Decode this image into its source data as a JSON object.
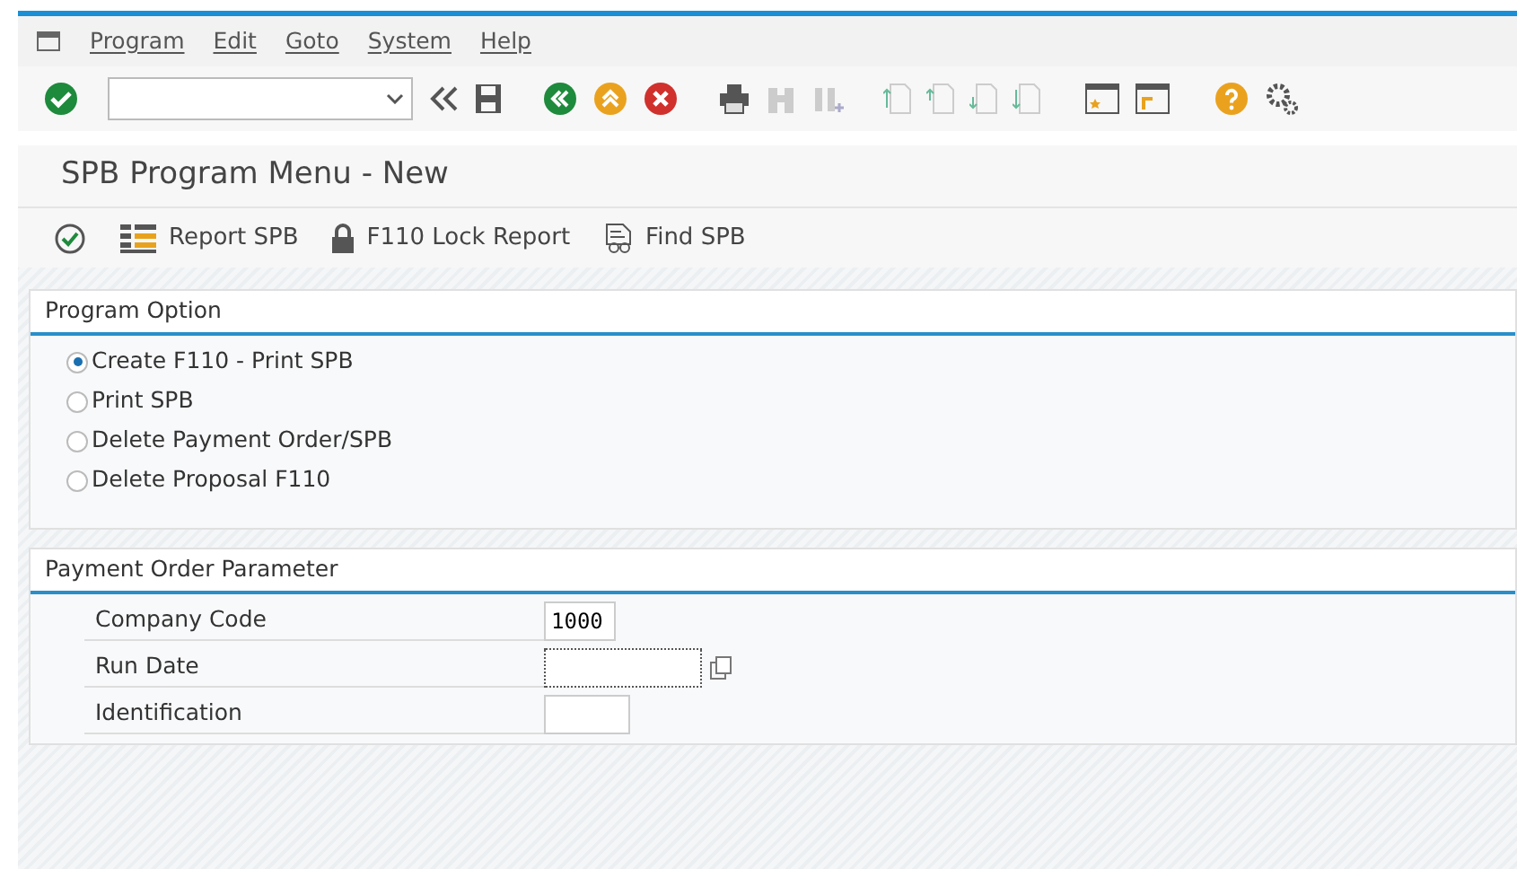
{
  "menu_bar": [
    "Program",
    "Edit",
    "Goto",
    "System",
    "Help"
  ],
  "title": "SPB Program Menu - New",
  "app_toolbar": [
    {
      "kind": "execute"
    },
    {
      "kind": "report",
      "label": "Report SPB"
    },
    {
      "kind": "lock",
      "label": "F110 Lock Report"
    },
    {
      "kind": "find",
      "label": "Find SPB"
    }
  ],
  "program_option": {
    "title": "Program Option",
    "options": [
      {
        "label": "Create F110 - Print SPB",
        "selected": true
      },
      {
        "label": "Print SPB",
        "selected": false
      },
      {
        "label": "Delete Payment Order/SPB",
        "selected": false
      },
      {
        "label": "Delete Proposal F110",
        "selected": false
      }
    ]
  },
  "payment_order_parameter": {
    "title": "Payment Order Parameter",
    "fields": [
      {
        "label": "Company Code",
        "value": "1000",
        "kind": "short",
        "focused": false
      },
      {
        "label": "Run Date",
        "kind": "date",
        "focused": true
      },
      {
        "label": "Identification",
        "kind": "id",
        "focused": false
      }
    ]
  }
}
